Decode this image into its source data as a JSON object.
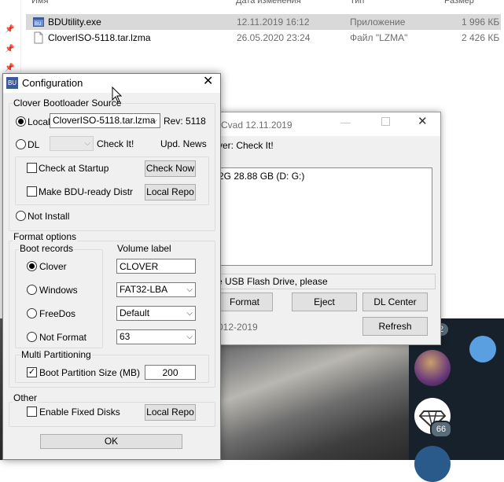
{
  "explorer": {
    "columns": [
      "Имя",
      "Дата изменения",
      "Тип",
      "Размер"
    ],
    "files": [
      {
        "name": "BDUtility.exe",
        "date": "12.11.2019 16:12",
        "type": "Приложение",
        "size": "1 996 КБ",
        "selected": true
      },
      {
        "name": "CloverISO-5118.tar.lzma",
        "date": "26.05.2020 23:24",
        "type": "Файл \"LZMA\"",
        "size": "2 426 КБ",
        "selected": false
      }
    ]
  },
  "bg_window": {
    "title": "Cvad 12.11.2019",
    "status": "ver: Check It!",
    "drive": "2G 28.88 GB (D: G:)",
    "hint": "e USB Flash Drive, please",
    "copyright": "012-2019",
    "buttons": {
      "format": "Format",
      "eject": "Eject",
      "dl_center": "DL Center",
      "refresh": "Refresh"
    }
  },
  "telegram": {
    "badge_top": "2",
    "badge_bottom": "66"
  },
  "dialog": {
    "title": "Configuration",
    "icon_text": "BU",
    "source_group": "Clover Bootloader Source",
    "local_label": "Local",
    "local_file": "CloverISO-5118.tar.lzma",
    "rev": "Rev: 5118",
    "dl_label": "DL",
    "check_it": "Check It!",
    "upd_news": "Upd. News",
    "check_startup": "Check at Startup",
    "check_now": "Check Now",
    "make_bdu": "Make BDU-ready Distr",
    "local_repo": "Local Repo",
    "not_install": "Not Install",
    "format_group": "Format options",
    "boot_records": "Boot records",
    "boot_options": [
      "Clover",
      "Windows",
      "FreeDos",
      "Not Format"
    ],
    "volume_label_caption": "Volume label",
    "volume_label": "CLOVER",
    "fs_value": "FAT32-LBA",
    "align_value": "Default",
    "heads_value": "63",
    "multi_group": "Multi Partitioning",
    "boot_partition_label": "Boot Partition Size (MB)",
    "boot_partition_value": "200",
    "other_group": "Other",
    "enable_fixed": "Enable Fixed Disks",
    "local_repo2": "Local Repo",
    "ok": "OK"
  }
}
